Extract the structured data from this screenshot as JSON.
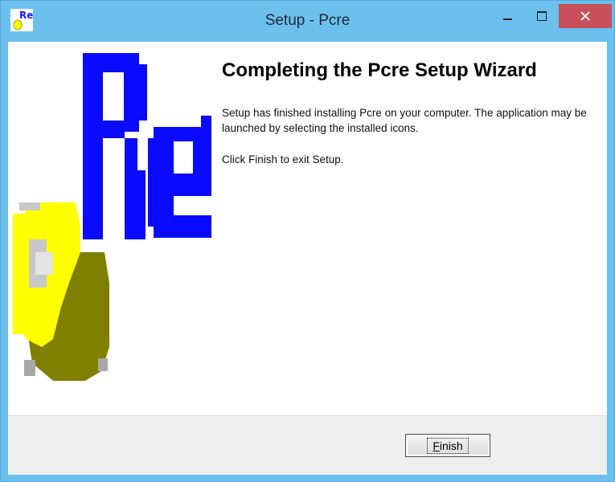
{
  "window": {
    "title": "Setup - Pcre",
    "app_icon": "pcre-setup-icon",
    "controls": [
      "minimize-icon",
      "maximize-icon",
      "close-icon"
    ],
    "title_bar_color": "#6cc0ee",
    "close_color": "#c7505a"
  },
  "banner": {
    "logo_text": "Re"
  },
  "main": {
    "heading": "Completing the Pcre Setup Wizard",
    "paragraph1": "Setup has finished installing Pcre on your computer. The application may be launched by selecting the installed icons.",
    "paragraph2": "Click Finish to exit Setup."
  },
  "footer": {
    "finish_mnemonic": "F",
    "finish_rest": "inish"
  }
}
